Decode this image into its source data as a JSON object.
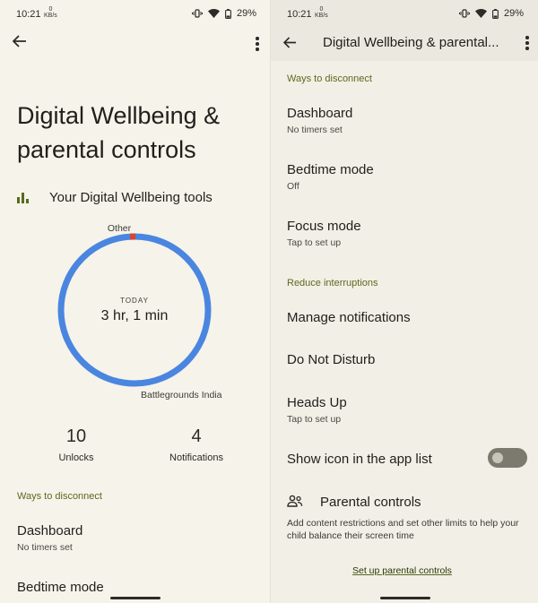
{
  "status": {
    "time": "10:21",
    "kbs_value": "0",
    "kbs_unit": "KB/s",
    "battery": "29%"
  },
  "left": {
    "title": "Digital Wellbeing & parental controls",
    "tools_label": "Your Digital Wellbeing tools",
    "chart": {
      "today_label": "TODAY",
      "total": "3 hr, 1 min",
      "label_top": "Other",
      "label_bottom": "Battlegrounds India"
    },
    "stats": [
      {
        "num": "10",
        "label": "Unlocks"
      },
      {
        "num": "4",
        "label": "Notifications"
      }
    ],
    "section": "Ways to disconnect",
    "items": [
      {
        "title": "Dashboard",
        "sub": "No timers set"
      },
      {
        "title": "Bedtime mode"
      }
    ]
  },
  "right": {
    "appbar_title": "Digital Wellbeing & parental...",
    "section1": "Ways to disconnect",
    "items1": [
      {
        "title": "Dashboard",
        "sub": "No timers set"
      },
      {
        "title": "Bedtime mode",
        "sub": "Off"
      },
      {
        "title": "Focus mode",
        "sub": "Tap to set up"
      }
    ],
    "section2": "Reduce interruptions",
    "items2": [
      {
        "title": "Manage notifications"
      },
      {
        "title": "Do Not Disturb"
      },
      {
        "title": "Heads Up",
        "sub": "Tap to set up"
      }
    ],
    "toggle_label": "Show icon in the app list",
    "toggle_on": false,
    "parental_title": "Parental controls",
    "parental_desc": "Add content restrictions and set other limits to help your child balance their screen time",
    "setup_link": "Set up parental controls"
  },
  "colors": {
    "accent": "#5a6a1e",
    "ring": "#4a86e0",
    "ring_other": "#d9442f"
  }
}
